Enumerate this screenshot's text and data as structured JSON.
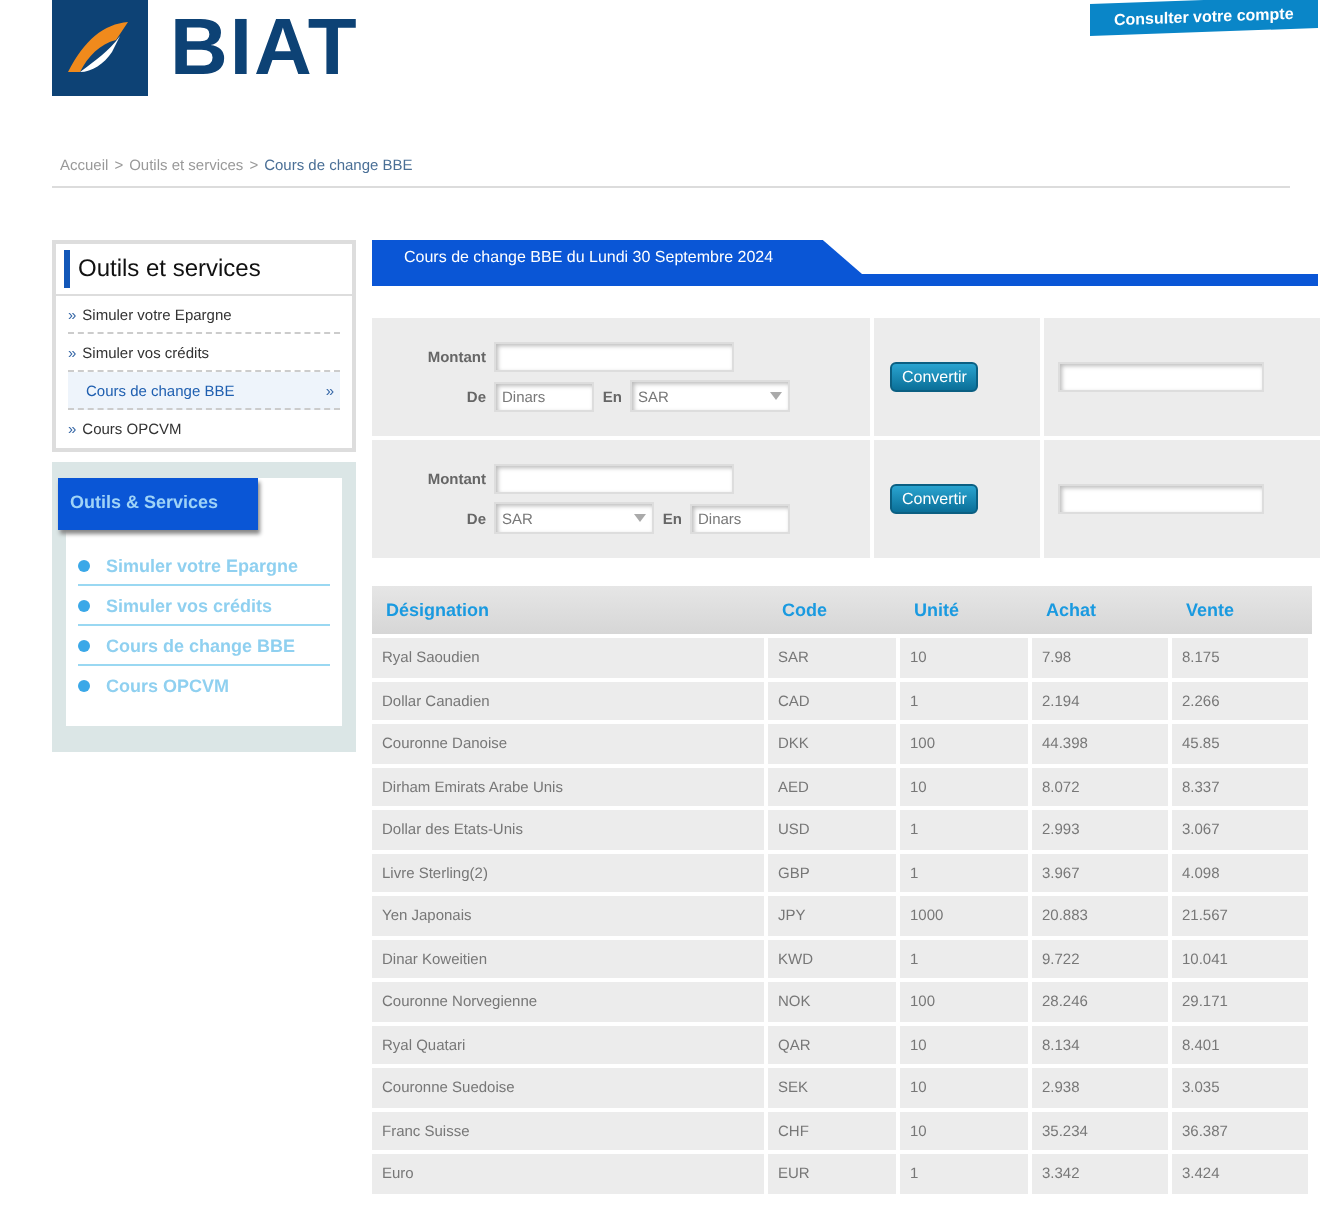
{
  "header": {
    "logo_text": "BIAT",
    "account_button": "Consulter votre compte"
  },
  "breadcrumb": [
    {
      "label": "Accueil",
      "current": false
    },
    {
      "label": "Outils et services",
      "current": false
    },
    {
      "label": "Cours de change BBE",
      "current": true
    }
  ],
  "breadcrumb_separator": ">",
  "sidebar": {
    "title": "Outils et services",
    "marker": "»",
    "items": [
      {
        "label": "Simuler votre Epargne",
        "selected": false
      },
      {
        "label": "Simuler vos crédits",
        "selected": false
      },
      {
        "label": "Cours de change BBE",
        "selected": true
      },
      {
        "label": "Cours OPCVM",
        "selected": false
      }
    ]
  },
  "services_panel": {
    "title": "Outils & Services",
    "items": [
      "Simuler votre Epargne",
      "Simuler vos crédits",
      "Cours de change BBE",
      "Cours OPCVM"
    ]
  },
  "page_tab": "Cours de change BBE du Lundi 30 Septembre 2024",
  "converters": [
    {
      "amount_label": "Montant",
      "from_label": "De",
      "to_label": "En",
      "from": {
        "kind": "text",
        "value": "Dinars"
      },
      "to": {
        "kind": "select",
        "value": "SAR"
      },
      "button": "Convertir"
    },
    {
      "amount_label": "Montant",
      "from_label": "De",
      "to_label": "En",
      "from": {
        "kind": "select",
        "value": "SAR"
      },
      "to": {
        "kind": "text",
        "value": "Dinars"
      },
      "button": "Convertir"
    }
  ],
  "table": {
    "columns": [
      "Désignation",
      "Code",
      "Unité",
      "Achat",
      "Vente"
    ],
    "rows": [
      [
        "Ryal Saoudien",
        "SAR",
        "10",
        "7.98",
        "8.175"
      ],
      [
        "Dollar Canadien",
        "CAD",
        "1",
        "2.194",
        "2.266"
      ],
      [
        "Couronne Danoise",
        "DKK",
        "100",
        "44.398",
        "45.85"
      ],
      [
        "Dirham Emirats Arabe Unis",
        "AED",
        "10",
        "8.072",
        "8.337"
      ],
      [
        "Dollar des Etats-Unis",
        "USD",
        "1",
        "2.993",
        "3.067"
      ],
      [
        "Livre Sterling(2)",
        "GBP",
        "1",
        "3.967",
        "4.098"
      ],
      [
        "Yen Japonais",
        "JPY",
        "1000",
        "20.883",
        "21.567"
      ],
      [
        "Dinar Koweitien",
        "KWD",
        "1",
        "9.722",
        "10.041"
      ],
      [
        "Couronne Norvegienne",
        "NOK",
        "100",
        "28.246",
        "29.171"
      ],
      [
        "Ryal Quatari",
        "QAR",
        "10",
        "8.134",
        "8.401"
      ],
      [
        "Couronne Suedoise",
        "SEK",
        "10",
        "2.938",
        "3.035"
      ],
      [
        "Franc Suisse",
        "CHF",
        "10",
        "35.234",
        "36.387"
      ],
      [
        "Euro",
        "EUR",
        "1",
        "3.342",
        "3.424"
      ]
    ]
  }
}
